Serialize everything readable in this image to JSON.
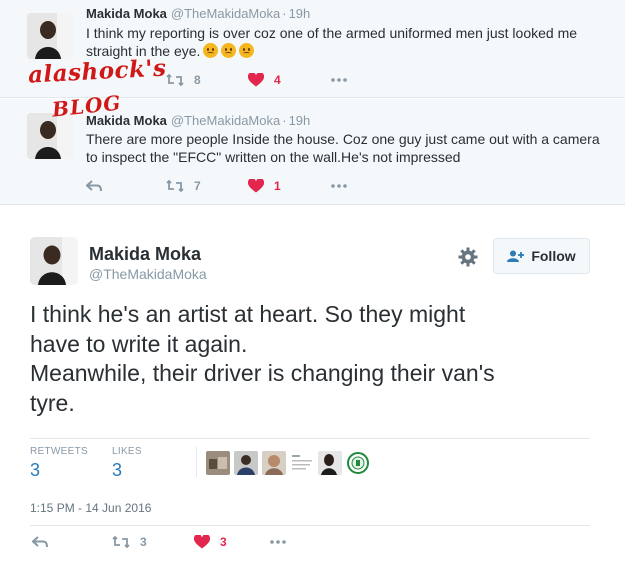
{
  "colors": {
    "accent": "#2b7bb9",
    "like": "#e2264d",
    "muted": "#8899a6",
    "text": "#292f33"
  },
  "watermark": {
    "line1": "alashock's",
    "line2": "BLOG"
  },
  "tweets": [
    {
      "name": "Makida Moka",
      "handle": "@TheMakidaMoka",
      "separator": "·",
      "time": "19h",
      "text": "I think my reporting is over coz one of the armed uniformed men just looked me straight in the eye.",
      "emoji_count": 3,
      "retweets": "8",
      "likes": "4"
    },
    {
      "name": "Makida Moka",
      "handle": "@TheMakidaMoka",
      "separator": "·",
      "time": "19h",
      "text": "There are more people Inside the house. Coz one guy just came out with a camera to inspect the \"EFCC\" written on the wall.He's not impressed",
      "retweets": "7",
      "likes": "1"
    }
  ],
  "main_tweet": {
    "name": "Makida Moka",
    "handle": "@TheMakidaMoka",
    "follow_label": "Follow",
    "text_line1": "I think he's an artist at heart. So they might",
    "text_line2": "have to write it again.",
    "text_line3": "Meanwhile, their driver is changing their van's",
    "text_line4": "tyre.",
    "retweets_label": "RETWEETS",
    "retweets": "3",
    "likes_label": "LIKES",
    "likes": "3",
    "timestamp": "1:15 PM - 14 Jun 2016",
    "action_retweets": "3",
    "action_likes": "3"
  },
  "icons": [
    "reply-icon",
    "retweet-icon",
    "heart-icon",
    "more-icon",
    "gear-icon",
    "follow-person-icon"
  ]
}
